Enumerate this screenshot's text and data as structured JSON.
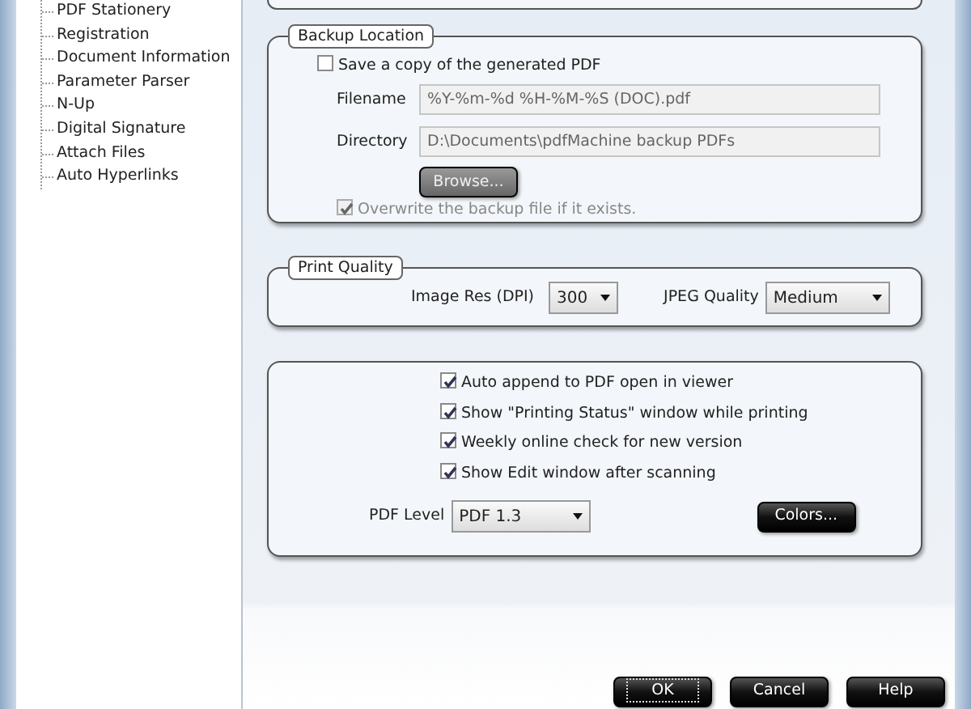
{
  "tree": {
    "items": [
      {
        "label": "PDF Stationery"
      },
      {
        "label": "Registration"
      },
      {
        "label": "Document Information"
      },
      {
        "label": "Parameter Parser"
      },
      {
        "label": "N-Up"
      },
      {
        "label": "Digital Signature"
      },
      {
        "label": "Attach Files"
      },
      {
        "label": "Auto Hyperlinks"
      }
    ]
  },
  "backup_location": {
    "title": "Backup Location",
    "save_copy": {
      "label": "Save a copy of the generated PDF",
      "checked": false,
      "disabled": false
    },
    "filename": {
      "label": "Filename",
      "value": "%Y-%m-%d %H-%M-%S (DOC).pdf",
      "disabled": true
    },
    "directory": {
      "label": "Directory",
      "value": "D:\\Documents\\pdfMachine backup PDFs",
      "disabled": true
    },
    "browse_button": {
      "label": "Browse...",
      "disabled": true
    },
    "overwrite": {
      "label": "Overwrite the backup file if it exists.",
      "checked": true,
      "disabled": true
    }
  },
  "print_quality": {
    "title": "Print Quality",
    "image_res": {
      "label": "Image Res (DPI)",
      "value": "300"
    },
    "jpeg_quality": {
      "label": "JPEG Quality",
      "value": "Medium"
    }
  },
  "options": {
    "checkboxes": [
      {
        "label": "Auto append to PDF open in viewer",
        "checked": true
      },
      {
        "label": "Show \"Printing Status\" window while printing",
        "checked": true
      },
      {
        "label": "Weekly online check for new version",
        "checked": true
      },
      {
        "label": "Show Edit window after scanning",
        "checked": true
      }
    ],
    "pdf_level": {
      "label": "PDF Level",
      "value": "PDF 1.3"
    },
    "colors_button": {
      "label": "Colors..."
    }
  },
  "buttons": [
    {
      "label": "OK",
      "focused": true
    },
    {
      "label": "Cancel",
      "focused": false
    },
    {
      "label": "Help",
      "focused": false
    }
  ]
}
